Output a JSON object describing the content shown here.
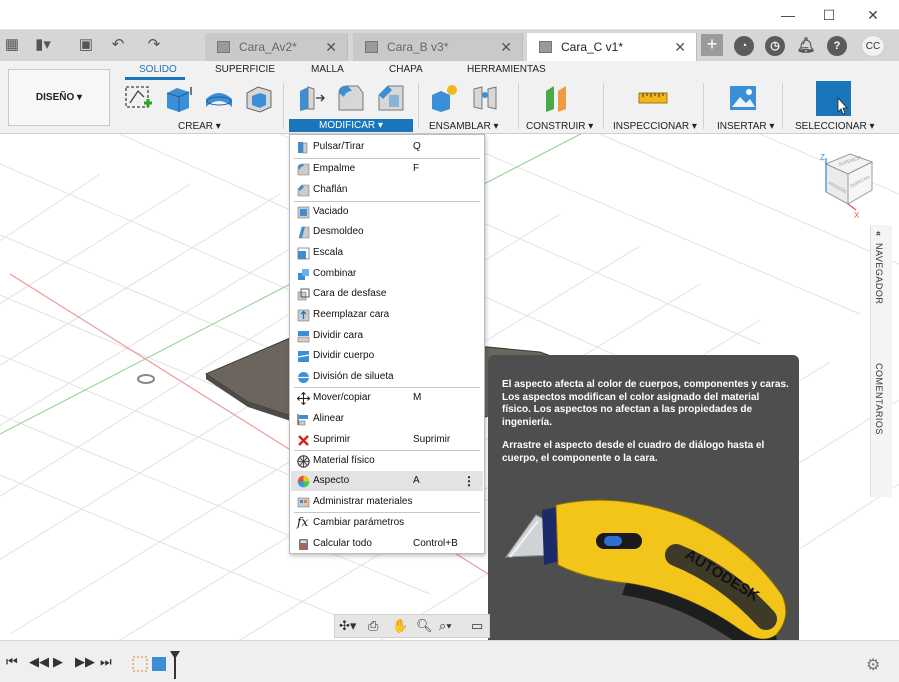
{
  "window": {
    "minimize": "—",
    "maximize": "☐",
    "close": "✕"
  },
  "tabs": [
    {
      "title": "Cara_Av2*",
      "close": "✕"
    },
    {
      "title": "Cara_B v3*",
      "close": "✕"
    },
    {
      "title": "Cara_C v1*",
      "close": "✕"
    }
  ],
  "user_initials": "CC",
  "toolbar": {
    "design_label": "DISEÑO ▾",
    "ribbon_tabs": [
      "SOLIDO",
      "SUPERFICIE",
      "MALLA",
      "CHAPA",
      "HERRAMIENTAS"
    ],
    "groups": [
      "CREAR ▾",
      "MODIFICAR ▾",
      "ENSAMBLAR ▾",
      "CONSTRUIR ▾",
      "INSPECCIONAR ▾",
      "INSERTAR ▾",
      "SELECCIONAR ▾"
    ]
  },
  "menu": {
    "items": [
      {
        "label": "Pulsar/Tirar",
        "shortcut": "Q",
        "icon": "press-pull-icon"
      },
      {
        "label": "Empalme",
        "shortcut": "F",
        "icon": "fillet-icon"
      },
      {
        "label": "Chaflán",
        "shortcut": "",
        "icon": "chamfer-icon"
      },
      {
        "label": "Vaciado",
        "shortcut": "",
        "icon": "shell-icon"
      },
      {
        "label": "Desmoldeo",
        "shortcut": "",
        "icon": "draft-icon"
      },
      {
        "label": "Escala",
        "shortcut": "",
        "icon": "scale-icon"
      },
      {
        "label": "Combinar",
        "shortcut": "",
        "icon": "combine-icon"
      },
      {
        "label": "Cara de desfase",
        "shortcut": "",
        "icon": "offset-face-icon"
      },
      {
        "label": "Reemplazar cara",
        "shortcut": "",
        "icon": "replace-face-icon"
      },
      {
        "label": "Dividir cara",
        "shortcut": "",
        "icon": "split-face-icon"
      },
      {
        "label": "Dividir cuerpo",
        "shortcut": "",
        "icon": "split-body-icon"
      },
      {
        "label": "División de silueta",
        "shortcut": "",
        "icon": "silhouette-split-icon"
      },
      {
        "label": "Mover/copiar",
        "shortcut": "M",
        "icon": "move-icon"
      },
      {
        "label": "Alinear",
        "shortcut": "",
        "icon": "align-icon"
      },
      {
        "label": "Suprimir",
        "shortcut": "Suprimir",
        "icon": "delete-icon"
      },
      {
        "label": "Material físico",
        "shortcut": "",
        "icon": "physical-material-icon"
      },
      {
        "label": "Aspecto",
        "shortcut": "A",
        "icon": "appearance-icon"
      },
      {
        "label": "Administrar materiales",
        "shortcut": "",
        "icon": "manage-materials-icon"
      },
      {
        "label": "Cambiar parámetros",
        "shortcut": "",
        "icon": "change-parameters-icon"
      },
      {
        "label": "Calcular todo",
        "shortcut": "Control+B",
        "icon": "compute-all-icon"
      }
    ]
  },
  "tooltip": {
    "para1": "El aspecto afecta al color de cuerpos, componentes y caras. Los aspectos modifican el color asignado del material físico. Los aspectos no afectan a las propiedades de ingeniería.",
    "para2": "Arrastre el aspecto desde el cuadro de diálogo hasta el cuerpo, el componente o la cara.",
    "brand": "AUTODESK"
  },
  "side_panel": {
    "navigator": "NAVEGADOR",
    "comments": "COMENTARIOS"
  },
  "viewcube": {
    "top": "SUPERIOR",
    "front": "FRONTAL",
    "right": "DERECHA",
    "z": "Z",
    "x": "X"
  },
  "colors": {
    "accent": "#1b75bb",
    "menu_highlight": "#e3e3e3",
    "tooltip_bg": "#4e4e4e",
    "body_plate": "#6b655e"
  }
}
